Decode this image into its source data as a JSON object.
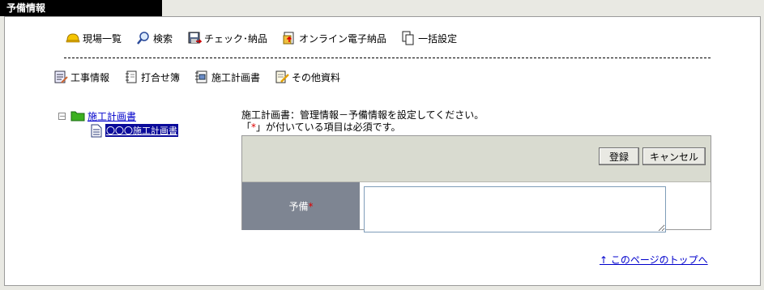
{
  "window": {
    "title": "予備情報"
  },
  "toolbar_main": [
    {
      "label": "現場一覧",
      "icon": "hardhat-icon"
    },
    {
      "label": "検索",
      "icon": "magnifier-icon"
    },
    {
      "label": "チェック･納品",
      "icon": "floppy-icon"
    },
    {
      "label": "オンライン電子納品",
      "icon": "online-upload-icon"
    },
    {
      "label": "一括設定",
      "icon": "copy-pages-icon"
    }
  ],
  "toolbar_sub": [
    {
      "label": "工事情報",
      "icon": "notebook-pen-icon"
    },
    {
      "label": "打合せ簿",
      "icon": "ring-notebook-icon"
    },
    {
      "label": "施工計画書",
      "icon": "spiral-document-icon"
    },
    {
      "label": "その他資料",
      "icon": "note-pencil-icon"
    }
  ],
  "tree": {
    "root_toggle": "－",
    "root_label": "施工計画書",
    "child_label": "〇〇〇施工計画書"
  },
  "instructions": {
    "line1": "施工計画書：管理情報－予備情報を設定してください。",
    "line2_prefix": "「",
    "line2_req": "*",
    "line2_suffix": "」が付いている項目は必須です。"
  },
  "form": {
    "register_label": "登録",
    "cancel_label": "キャンセル",
    "field_label": "予備",
    "field_required_mark": "*",
    "field_value": ""
  },
  "footer": {
    "back_to_top": "↑ このページのトップへ"
  },
  "colors": {
    "label_bg": "#7e8592",
    "form_header_bg": "#d9dbd0",
    "required": "#dd0000",
    "link": "#0000cc",
    "selected_bg": "#0a0a9a"
  }
}
